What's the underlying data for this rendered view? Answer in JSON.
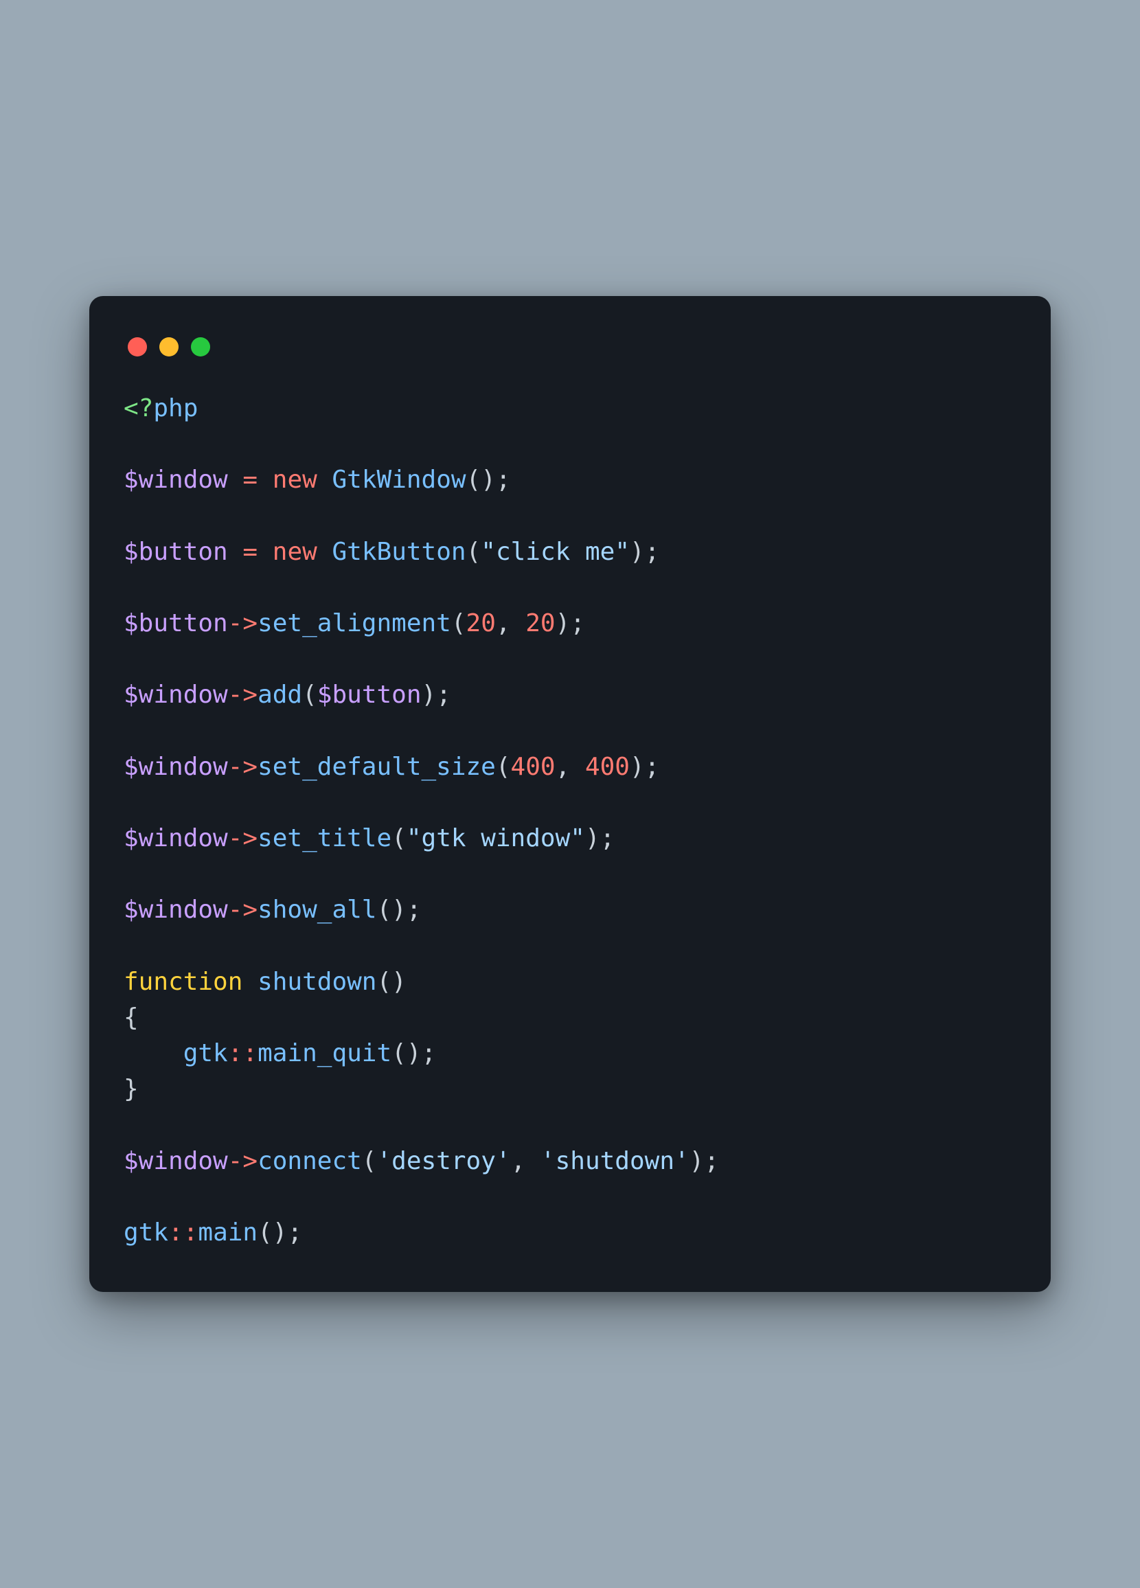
{
  "colors": {
    "background": "#9aa9b5",
    "window_bg": "#161b22",
    "dot_red": "#ff5f56",
    "dot_yellow": "#ffbd2e",
    "dot_green": "#27c93f"
  },
  "code": {
    "open_tag": "<?",
    "php": "php",
    "var_window": "$window",
    "var_button": "$button",
    "eq": "=",
    "kw_new": "new",
    "kw_function": "function",
    "cls_GtkWindow": "GtkWindow",
    "cls_GtkButton": "GtkButton",
    "cls_gtk": "gtk",
    "arrow": "->",
    "scope": "::",
    "fn_set_alignment": "set_alignment",
    "fn_add": "add",
    "fn_set_default_size": "set_default_size",
    "fn_set_title": "set_title",
    "fn_show_all": "show_all",
    "fn_shutdown": "shutdown",
    "fn_main_quit": "main_quit",
    "fn_connect": "connect",
    "fn_main": "main",
    "str_click_me": "\"click me\"",
    "str_gtk_window": "\"gtk window\"",
    "str_destroy": "'destroy'",
    "str_shutdown": "'shutdown'",
    "num_20a": "20",
    "num_20b": "20",
    "num_400a": "400",
    "num_400b": "400",
    "p_open": "(",
    "p_close": ")",
    "brace_open": "{",
    "brace_close": "}",
    "semi": ";",
    "comma_sp": ", ",
    "sp": " ",
    "indent": "    "
  }
}
